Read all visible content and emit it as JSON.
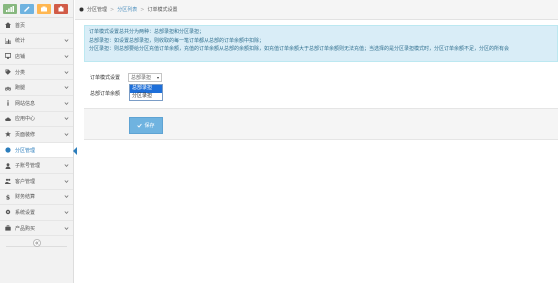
{
  "sidebar": {
    "shortcuts": [
      {
        "icon": "signal-icon",
        "color": "#87b87f"
      },
      {
        "icon": "pencil-icon",
        "color": "#6fb3e0"
      },
      {
        "icon": "group-icon",
        "color": "#ffb752"
      },
      {
        "icon": "cogs-icon",
        "color": "#d15b47"
      }
    ],
    "items": [
      {
        "label": "首页",
        "icon": "home-icon",
        "has_arrow": false
      },
      {
        "label": "统计",
        "icon": "chart-icon",
        "has_arrow": true
      },
      {
        "label": "店铺",
        "icon": "monitor-icon",
        "has_arrow": true
      },
      {
        "label": "分类",
        "icon": "tag-icon",
        "has_arrow": true
      },
      {
        "label": "跑腿",
        "icon": "bicycle-icon",
        "has_arrow": true
      },
      {
        "label": "网站信息",
        "icon": "info-icon",
        "has_arrow": true
      },
      {
        "label": "应用中心",
        "icon": "cloud-icon",
        "has_arrow": true
      },
      {
        "label": "页面装修",
        "icon": "star-icon",
        "has_arrow": true
      },
      {
        "label": "分区管理",
        "icon": "circle-icon",
        "has_arrow": false,
        "active": true
      },
      {
        "label": "子账号管理",
        "icon": "user-icon",
        "has_arrow": true
      },
      {
        "label": "客户管理",
        "icon": "users-icon",
        "has_arrow": true
      },
      {
        "label": "财务结算",
        "icon": "dollar-icon",
        "has_arrow": true
      },
      {
        "label": "系统设置",
        "icon": "gear-icon",
        "has_arrow": true
      },
      {
        "label": "产品购买",
        "icon": "briefcase-icon",
        "has_arrow": true
      }
    ],
    "accent": "#2b7dbc"
  },
  "breadcrumb": {
    "items": [
      "分区管理",
      "分区列表",
      "订单模式设置"
    ]
  },
  "info": {
    "lines": [
      "订单模式设置总共分为两种：总部录担和分区录担；",
      "总部录担：如设置总部录担，则收取的每一笔订单都从总部的订单余额中扣除；",
      "分区录担：则总部要给分区充值订单余额，充值的订单余额从总部的余额扣除，如充值订单余额大于总部订单余额则无法充值；当选择的是分区录担模式时，分区订单余额不足，分区的所有会"
    ]
  },
  "form": {
    "mode_label": "订单模式设置",
    "mode_value": "总部录担",
    "balance_label": "总部订单余额",
    "options": [
      "总部录担",
      "分区录担"
    ],
    "selected_index": 0
  },
  "actions": {
    "save_label": "保存"
  }
}
